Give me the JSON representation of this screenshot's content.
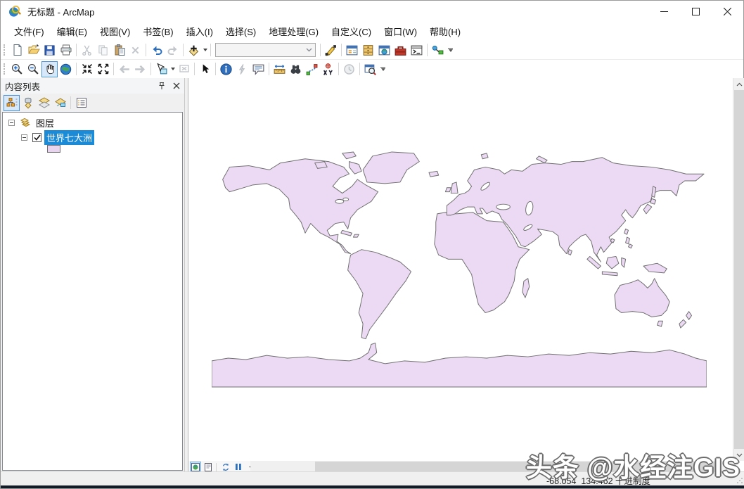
{
  "window": {
    "title": "无标题 - ArcMap",
    "controls": [
      "minimize",
      "maximize",
      "close"
    ]
  },
  "menu": {
    "items": [
      "文件(F)",
      "编辑(E)",
      "视图(V)",
      "书签(B)",
      "插入(I)",
      "选择(S)",
      "地理处理(G)",
      "自定义(C)",
      "窗口(W)",
      "帮助(H)"
    ]
  },
  "standard_toolbar": {
    "scale_combo_value": "",
    "icons": [
      "new-document-icon",
      "open-icon",
      "save-icon",
      "print-icon",
      "cut-icon",
      "copy-icon",
      "paste-icon",
      "delete-icon",
      "undo-icon",
      "redo-icon",
      "add-data-icon",
      "editor-pencil-icon",
      "toc-window-icon",
      "catalog-icon",
      "catalog-window-icon",
      "arctoolbox-icon",
      "python-window-icon",
      "model-builder-icon"
    ]
  },
  "tools_toolbar": {
    "icons": [
      "zoom-in-icon",
      "zoom-out-icon",
      "pan-icon",
      "full-extent-icon",
      "fixed-zoom-in-icon",
      "fixed-zoom-out-icon",
      "back-extent-icon",
      "forward-extent-icon",
      "select-features-icon",
      "clear-selection-icon",
      "select-elements-icon",
      "identify-icon",
      "hyperlink-icon",
      "html-popup-icon",
      "measure-icon",
      "find-icon",
      "find-route-icon",
      "go-to-xy-icon",
      "time-slider-icon",
      "viewer-window-icon"
    ],
    "active_tool": "pan"
  },
  "toc": {
    "title": "内容列表",
    "toolbar_icons": [
      "list-by-drawing-order-icon",
      "list-by-source-icon",
      "list-by-visibility-icon",
      "list-by-selection-icon",
      "options-icon"
    ],
    "tree": {
      "root_label": "图层",
      "layer_label": "世界七大洲",
      "layer_checked": true,
      "layer_selected": true
    }
  },
  "map": {
    "view_buttons": [
      "data-view",
      "layout-view"
    ],
    "nav_buttons": [
      "refresh",
      "pause",
      "scroll-left"
    ],
    "layer_shown": "世界七大洲 (world continents, equirectangular)"
  },
  "statusbar": {
    "coordinates": "-68.054  134.462 十进制度"
  },
  "watermark": {
    "text": "头条 @水经注GIS"
  },
  "colors": {
    "land_fill": "#ECD9F3",
    "land_outline": "#6F6F6F",
    "selection_blue": "#1B8BD8",
    "swatch_fill": "#E9D4F0",
    "accent_blue": "#2B6FC0"
  }
}
